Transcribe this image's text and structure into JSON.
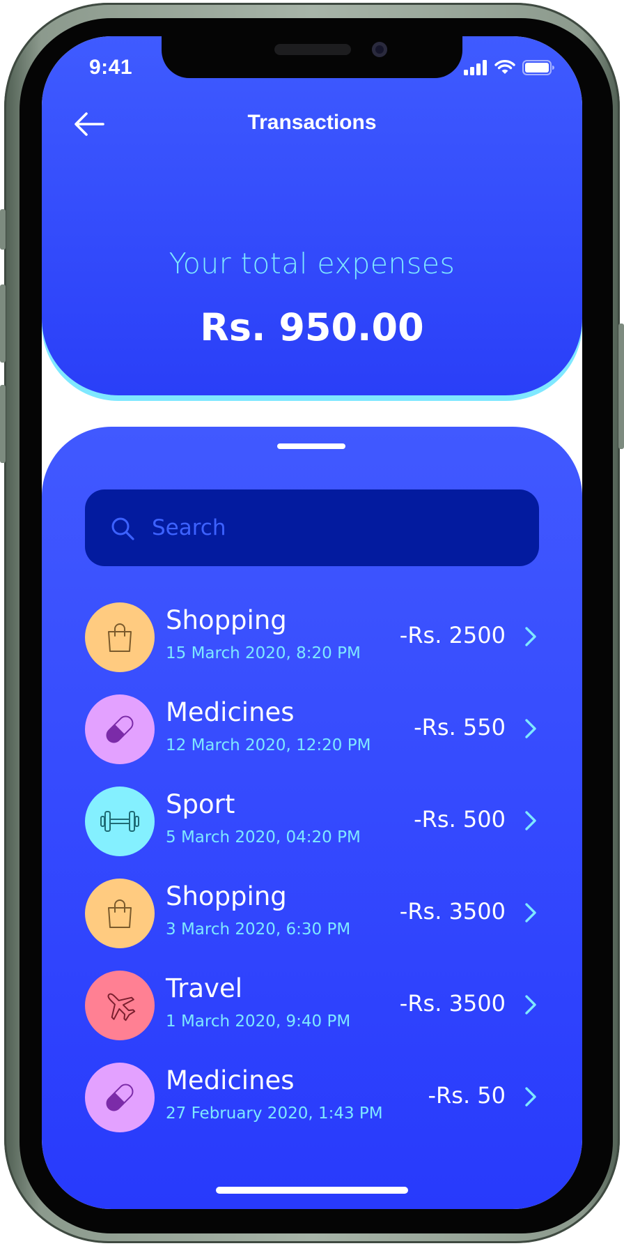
{
  "status_bar": {
    "time": "9:41",
    "signal_icon": "cellular-signal-icon",
    "wifi_icon": "wifi-icon",
    "battery_icon": "battery-icon"
  },
  "nav": {
    "back_icon": "arrow-left-icon",
    "title": "Transactions"
  },
  "summary": {
    "label": "Your total expenses",
    "amount": "Rs. 950.00"
  },
  "search": {
    "placeholder": "Search",
    "value": "",
    "icon": "search-icon"
  },
  "transactions": [
    {
      "category": "Shopping",
      "date": "15 March 2020, 8:20 PM",
      "amount": "-Rs. 2500",
      "icon": "shopping-bag-icon",
      "color": "#ffcb80"
    },
    {
      "category": "Medicines",
      "date": "12 March 2020, 12:20 PM",
      "amount": "-Rs. 550",
      "icon": "pill-icon",
      "color": "#e3a1ff"
    },
    {
      "category": "Sport",
      "date": "5 March 2020, 04:20 PM",
      "amount": "-Rs. 500",
      "icon": "dumbbell-icon",
      "color": "#84f0ff"
    },
    {
      "category": "Shopping",
      "date": "3 March 2020, 6:30 PM",
      "amount": "-Rs. 3500",
      "icon": "shopping-bag-icon",
      "color": "#ffcb80"
    },
    {
      "category": "Travel",
      "date": "1 March 2020, 9:40 PM",
      "amount": "-Rs. 3500",
      "icon": "airplane-icon",
      "color": "#ff8093"
    },
    {
      "category": "Medicines",
      "date": "27 February 2020, 1:43 PM",
      "amount": "-Rs. 50",
      "icon": "pill-icon",
      "color": "#e3a1ff"
    }
  ],
  "colors": {
    "primary": "#2a3ff8",
    "accent_cyan": "#7fe8ff",
    "search_background": "#031b9f",
    "text_white": "#ffffff"
  }
}
